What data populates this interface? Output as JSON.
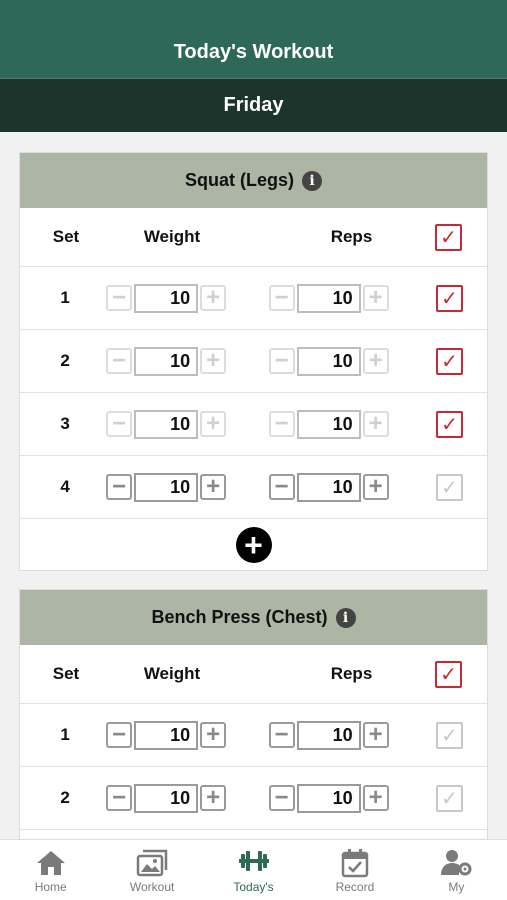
{
  "header": {
    "title": "Today's Workout"
  },
  "day": "Friday",
  "columns": {
    "set": "Set",
    "weight": "Weight",
    "reps": "Reps"
  },
  "exercises": [
    {
      "name": "Squat (Legs)",
      "all_checked": true,
      "sets": [
        {
          "set": "1",
          "weight": "10",
          "reps": "10",
          "done": true
        },
        {
          "set": "2",
          "weight": "10",
          "reps": "10",
          "done": true
        },
        {
          "set": "3",
          "weight": "10",
          "reps": "10",
          "done": true
        },
        {
          "set": "4",
          "weight": "10",
          "reps": "10",
          "done": false
        }
      ]
    },
    {
      "name": "Bench Press (Chest)",
      "all_checked": true,
      "sets": [
        {
          "set": "1",
          "weight": "10",
          "reps": "10",
          "done": false
        },
        {
          "set": "2",
          "weight": "10",
          "reps": "10",
          "done": false
        }
      ]
    }
  ],
  "icons": {
    "info": "info-icon",
    "add": "plus-circle-icon",
    "minus": "minus-icon",
    "plus": "plus-icon",
    "check": "checkmark-icon"
  },
  "tabs": [
    {
      "label": "Home",
      "icon": "home-icon",
      "active": false
    },
    {
      "label": "Workout",
      "icon": "photos-icon",
      "active": false
    },
    {
      "label": "Today's",
      "icon": "dumbbell-icon",
      "active": true
    },
    {
      "label": "Record",
      "icon": "calendar-check-icon",
      "active": false
    },
    {
      "label": "My",
      "icon": "user-gear-icon",
      "active": false
    }
  ],
  "colors": {
    "header": "#2e6957",
    "subheader": "#1b352d",
    "card_head": "#adb5a5",
    "check": "#c52b36",
    "active_tab": "#2e6957"
  }
}
